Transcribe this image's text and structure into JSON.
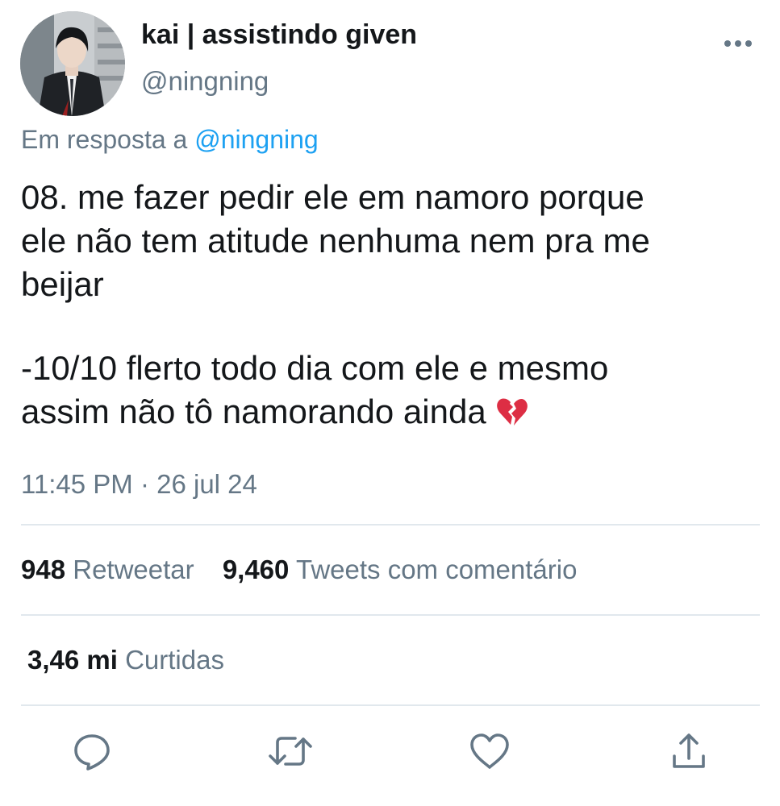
{
  "author": {
    "display_name": "kai | assistindo given",
    "handle": "@ningning"
  },
  "reply_to": {
    "prefix": "Em resposta a",
    "mention": "@ningning"
  },
  "tweet": {
    "lines_para1": [
      "08. me fazer pedir ele em namoro porque",
      "ele não tem atitude nenhuma nem pra me",
      "beijar"
    ],
    "lines_para2": [
      "-10/10 flerto todo dia com ele e mesmo",
      "assim não tô namorando ainda"
    ],
    "emoji": "broken-heart-icon",
    "timestamp": "11:45 PM · 26 jul 24"
  },
  "stats": {
    "retweets_count": "948",
    "retweets_label": "Retweetar",
    "quotes_count": "9,460",
    "quotes_label": "Tweets com comentário",
    "likes_count": "3,46 mi",
    "likes_label": "Curtidas"
  },
  "icons": {
    "more": "more-icon",
    "reply": "reply-icon",
    "retweet": "retweet-icon",
    "like": "like-icon",
    "share": "share-icon"
  },
  "colors": {
    "text": "#14171a",
    "secondary": "#657786",
    "link": "#1da1f2",
    "divider": "#e1e8ed",
    "emoji": "#dd2e44"
  }
}
